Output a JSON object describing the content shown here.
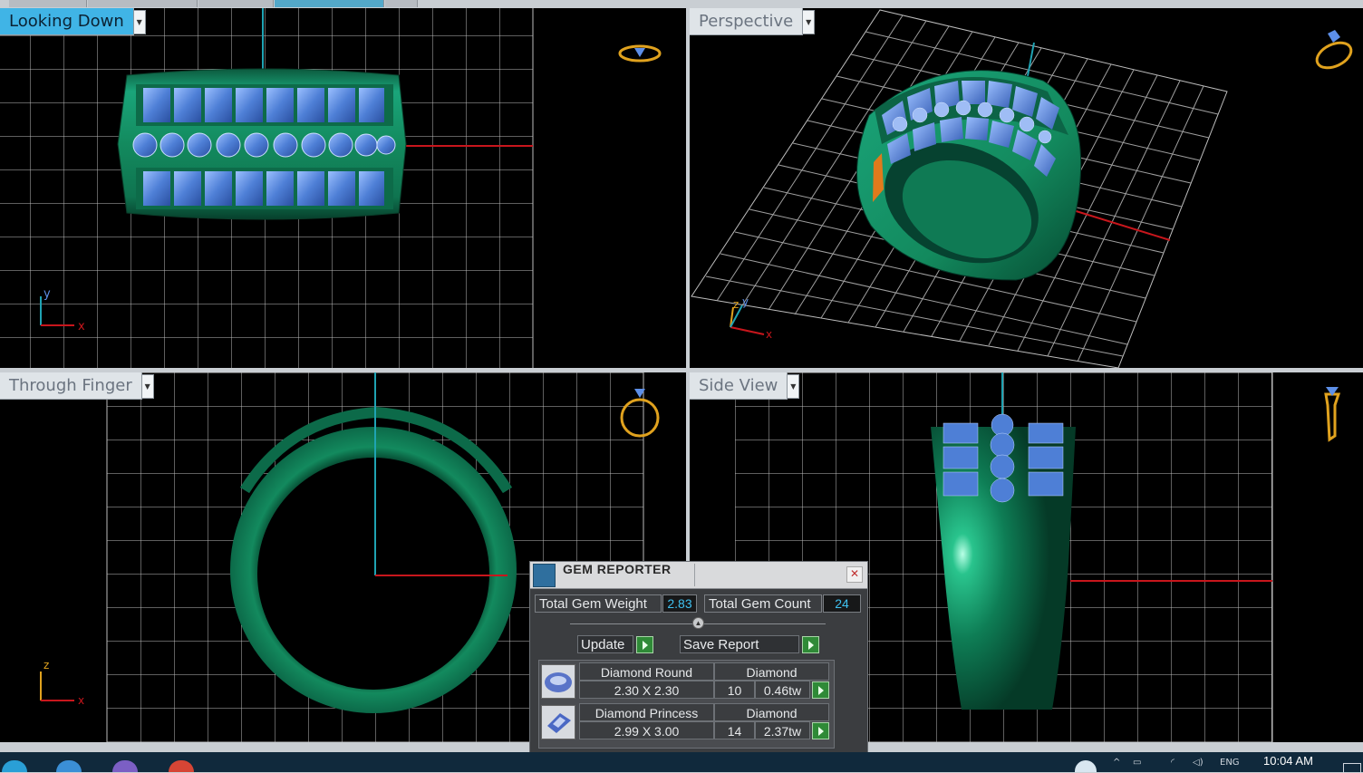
{
  "viewports": {
    "top_left": {
      "label": "Looking Down"
    },
    "top_right": {
      "label": "Perspective"
    },
    "bottom_left": {
      "label": "Through Finger"
    },
    "bottom_right": {
      "label": "Side View"
    }
  },
  "axes": {
    "x": "x",
    "y": "y",
    "z": "z"
  },
  "gem_reporter": {
    "title": "GEM REPORTER",
    "total_weight_label": "Total Gem Weight",
    "total_weight": "2.83",
    "total_count_label": "Total Gem Count",
    "total_count": "24",
    "update_label": "Update",
    "save_label": "Save Report",
    "gems": [
      {
        "name": "Diamond Round",
        "material": "Diamond",
        "size": "2.30 X 2.30",
        "count": "10",
        "weight": "0.46tw"
      },
      {
        "name": "Diamond Princess",
        "material": "Diamond",
        "size": "2.99 X 3.00",
        "count": "14",
        "weight": "2.37tw"
      }
    ]
  },
  "taskbar": {
    "time": "10:04 AM",
    "lang": "ENG"
  },
  "colors": {
    "metal": "#138a5e",
    "gem": "#4e7fd6",
    "grid": "#bfbfbf",
    "axis_red": "#c8161c",
    "axis_cyan": "#1fa3b3",
    "active_tab": "#40b4e6"
  }
}
